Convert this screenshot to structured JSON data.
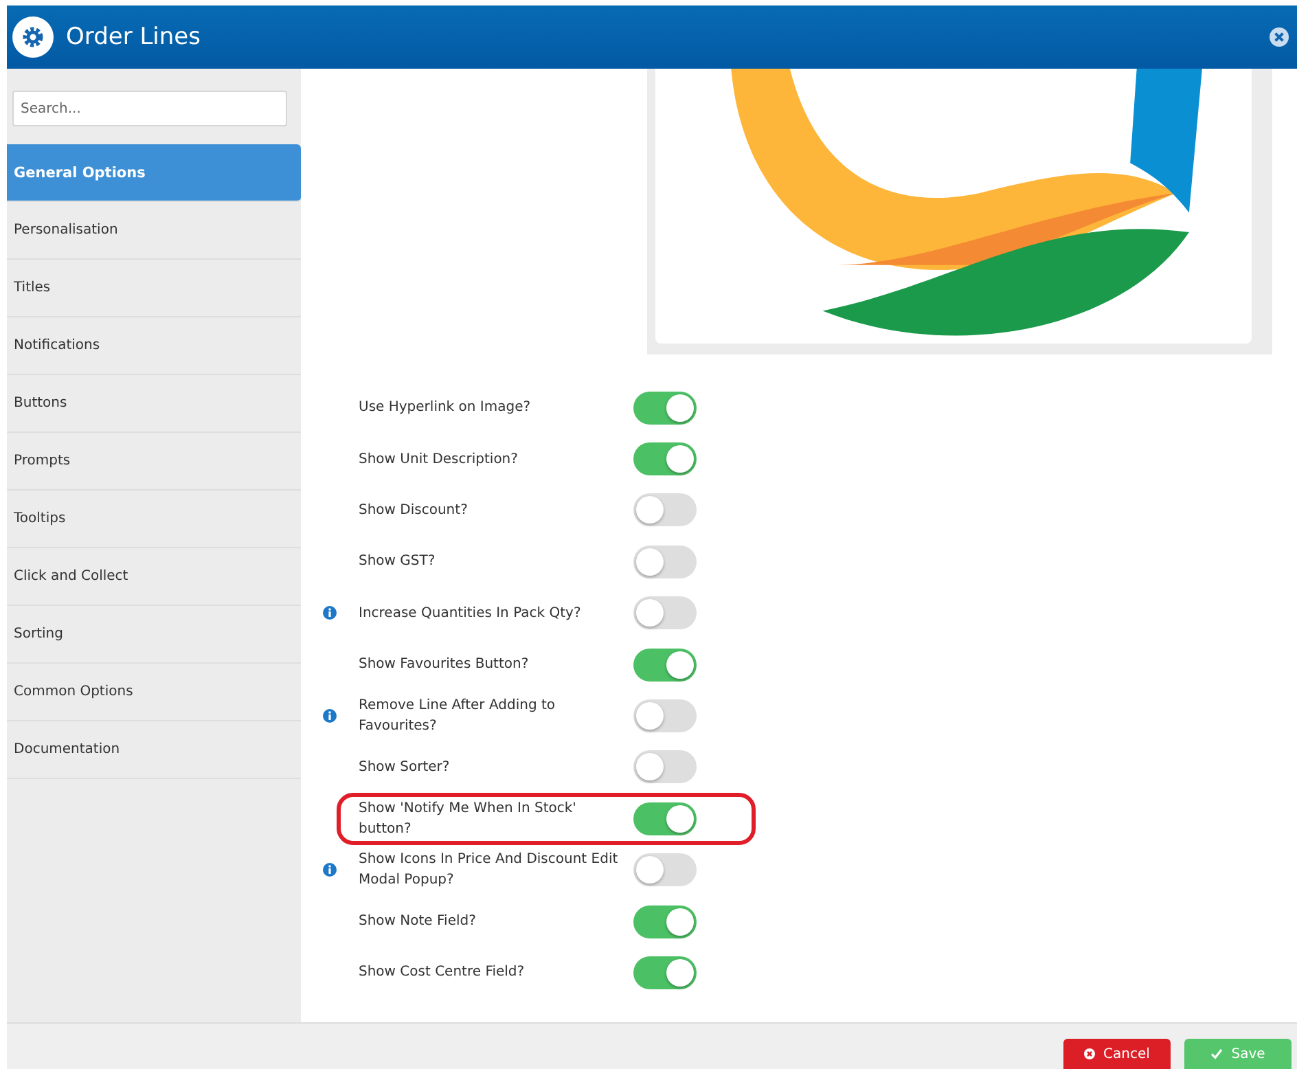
{
  "window": {
    "title": "Order Lines"
  },
  "sidebar": {
    "search": {
      "placeholder": "Search..."
    },
    "items": [
      {
        "label": "General Options",
        "selected": true
      },
      {
        "label": "Personalisation",
        "selected": false
      },
      {
        "label": "Titles",
        "selected": false
      },
      {
        "label": "Notifications",
        "selected": false
      },
      {
        "label": "Buttons",
        "selected": false
      },
      {
        "label": "Prompts",
        "selected": false
      },
      {
        "label": "Tooltips",
        "selected": false
      },
      {
        "label": "Click and Collect",
        "selected": false
      },
      {
        "label": "Sorting",
        "selected": false
      },
      {
        "label": "Common Options",
        "selected": false
      },
      {
        "label": "Documentation",
        "selected": false
      }
    ]
  },
  "options": [
    {
      "label": "Use Hyperlink on Image?",
      "on": true,
      "info": false,
      "highlighted": false
    },
    {
      "label": "Show Unit Description?",
      "on": true,
      "info": false,
      "highlighted": false
    },
    {
      "label": "Show Discount?",
      "on": false,
      "info": false,
      "highlighted": false
    },
    {
      "label": "Show GST?",
      "on": false,
      "info": false,
      "highlighted": false
    },
    {
      "label": "Increase Quantities In Pack Qty?",
      "on": false,
      "info": true,
      "highlighted": false
    },
    {
      "label": "Show Favourites Button?",
      "on": true,
      "info": false,
      "highlighted": false
    },
    {
      "label": "Remove Line After Adding to Favourites?",
      "on": false,
      "info": true,
      "highlighted": false
    },
    {
      "label": "Show Sorter?",
      "on": false,
      "info": false,
      "highlighted": false
    },
    {
      "label": "Show 'Notify Me When In Stock' button?",
      "on": true,
      "info": false,
      "highlighted": true
    },
    {
      "label": "Show Icons In Price And Discount Edit Modal Popup?",
      "on": false,
      "info": true,
      "highlighted": false
    },
    {
      "label": "Show Note Field?",
      "on": true,
      "info": false,
      "highlighted": false
    },
    {
      "label": "Show Cost Centre Field?",
      "on": true,
      "info": false,
      "highlighted": false
    }
  ],
  "footer": {
    "buttons": [
      {
        "label": "Cancel",
        "kind": "cancel"
      },
      {
        "label": "Save",
        "kind": "save"
      }
    ]
  }
}
